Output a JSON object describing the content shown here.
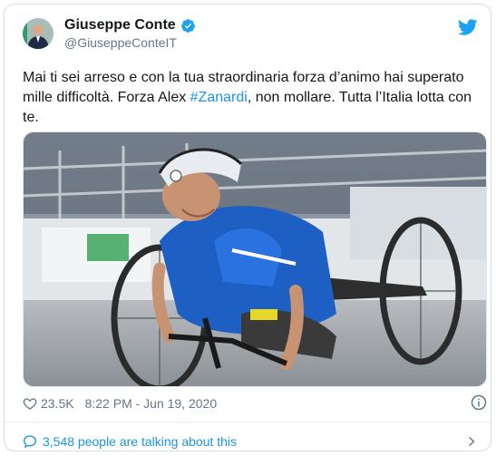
{
  "author": {
    "name": "Giuseppe Conte",
    "handle": "@GiuseppeConteIT"
  },
  "tweet": {
    "text_before": "Mai ti sei arreso e con la tua straordinaria forza d’animo hai superato mille difficoltà. Forza Alex ",
    "hashtag": "#Zanardi",
    "text_after": ", non mollare. Tutta l’Italia lotta con te."
  },
  "meta": {
    "likes": "23.5K",
    "timestamp": "8:22 PM - Jun 19, 2020"
  },
  "footer": {
    "talking": "3,548 people are talking about this"
  },
  "colors": {
    "accent": "#1b95e0",
    "text": "#14171a",
    "muted": "#657786"
  },
  "icons": [
    "verified-badge-icon",
    "twitter-bird-icon",
    "heart-icon",
    "info-icon",
    "speech-bubble-icon",
    "chevron-right-icon"
  ]
}
